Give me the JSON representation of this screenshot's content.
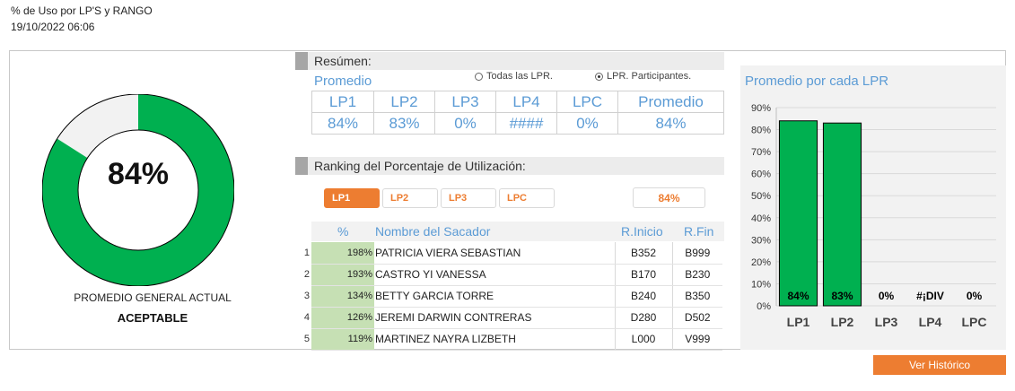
{
  "header": {
    "title": "% de Uso por LP'S y RANGO",
    "datetime": "19/10/2022 06:06"
  },
  "gauge": {
    "value_label": "84%",
    "fraction": 0.84,
    "caption": "PROMEDIO GENERAL ACTUAL",
    "status": "ACEPTABLE",
    "colors": {
      "fill": "#00b050",
      "track": "#f2f2f2",
      "outline": "#000000"
    }
  },
  "summary": {
    "title": "Resúmen:",
    "average_label": "Promedio",
    "options": [
      {
        "label": "Todas las LPR.",
        "selected": false
      },
      {
        "label": "LPR. Participantes.",
        "selected": true
      }
    ],
    "headers": [
      "LP1",
      "LP2",
      "LP3",
      "LP4",
      "LPC",
      "Promedio"
    ],
    "values": [
      "84%",
      "83%",
      "0%",
      "####",
      "0%",
      "84%"
    ]
  },
  "ranking": {
    "title": "Ranking del Porcentaje de Utilización:",
    "tabs": [
      {
        "label": "LP1",
        "active": true
      },
      {
        "label": "LP2",
        "active": false
      },
      {
        "label": "LP3",
        "active": false
      },
      {
        "label": "LPC",
        "active": false
      }
    ],
    "percent_box": "84%",
    "columns": {
      "pct": "%",
      "name": "Nombre del Sacador",
      "start": "R.Inicio",
      "end": "R.Fin"
    },
    "rows": [
      {
        "n": "1",
        "pct": "198%",
        "name": "PATRICIA VIERA SEBASTIAN",
        "start": "B352",
        "end": "B999"
      },
      {
        "n": "2",
        "pct": "193%",
        "name": "CASTRO YI VANESSA",
        "start": "B170",
        "end": "B230"
      },
      {
        "n": "3",
        "pct": "134%",
        "name": "BETTY GARCIA TORRE",
        "start": "B240",
        "end": "B350"
      },
      {
        "n": "4",
        "pct": "126%",
        "name": "JEREMI DARWIN CONTRERAS",
        "start": "D280",
        "end": "D502"
      },
      {
        "n": "5",
        "pct": "119%",
        "name": "MARTINEZ NAYRA LIZBETH",
        "start": "L000",
        "end": "V999"
      }
    ]
  },
  "chart_data": {
    "type": "bar",
    "title": "Promedio por cada LPR",
    "categories": [
      "LP1",
      "LP2",
      "LP3",
      "LP4",
      "LPC"
    ],
    "values": [
      84,
      83,
      0,
      null,
      0
    ],
    "data_labels": [
      "84%",
      "83%",
      "0%",
      "#¡DIV",
      "0%"
    ],
    "ylim": [
      0,
      90
    ],
    "yticks": [
      "0%",
      "10%",
      "20%",
      "30%",
      "40%",
      "50%",
      "60%",
      "70%",
      "80%",
      "90%"
    ],
    "grid": true,
    "bar_color": "#00b050"
  },
  "actions": {
    "history_button": "Ver Histórico"
  }
}
